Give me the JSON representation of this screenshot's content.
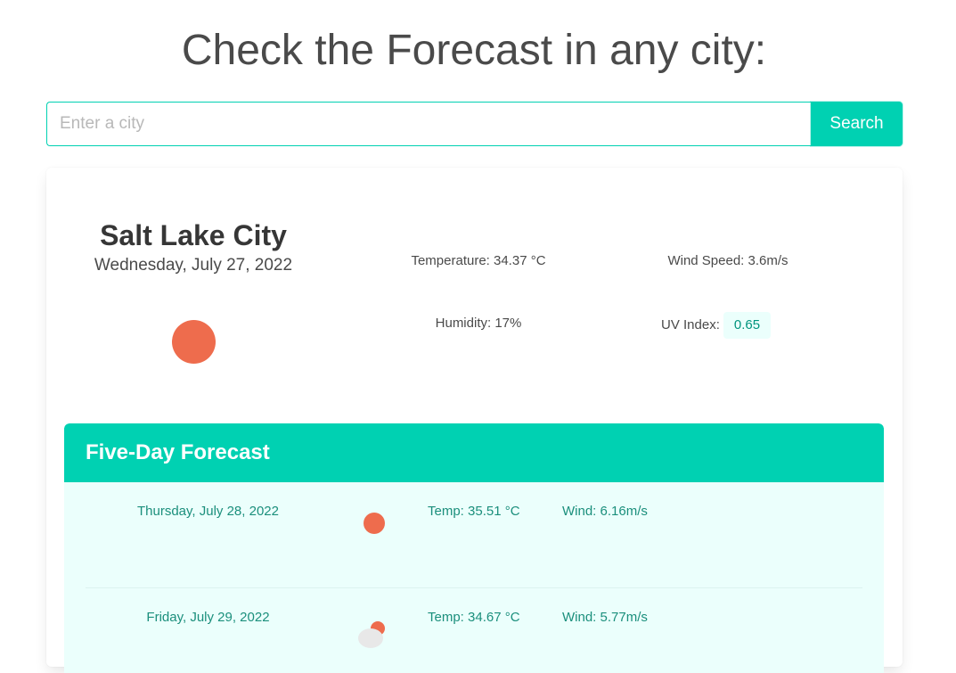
{
  "header": {
    "title": "Check the Forecast in any city:"
  },
  "search": {
    "placeholder": "Enter a city",
    "button_label": "Search"
  },
  "current": {
    "city": "Salt Lake City",
    "date": "Wednesday, July 27, 2022",
    "icon": "sun-icon",
    "temperature": "Temperature: 34.37 °C",
    "wind": "Wind Speed: 3.6m/s",
    "humidity": "Humidity: 17%",
    "uv_label": "UV Index:",
    "uv_value": "0.65"
  },
  "forecast": {
    "title": "Five-Day Forecast",
    "days": [
      {
        "date": "Thursday, July 28, 2022",
        "temp": "Temp: 35.51 °C",
        "wind": "Wind: 6.16m/s",
        "icon": "sun-icon"
      },
      {
        "date": "Friday, July 29, 2022",
        "temp": "Temp: 34.67 °C",
        "wind": "Wind: 5.77m/s",
        "icon": "partly-cloudy-icon"
      }
    ]
  },
  "colors": {
    "accent": "#00d1b2",
    "sun": "#ee6c4d",
    "forecast_bg": "#ebfffc",
    "forecast_text": "#1b8f7c"
  }
}
